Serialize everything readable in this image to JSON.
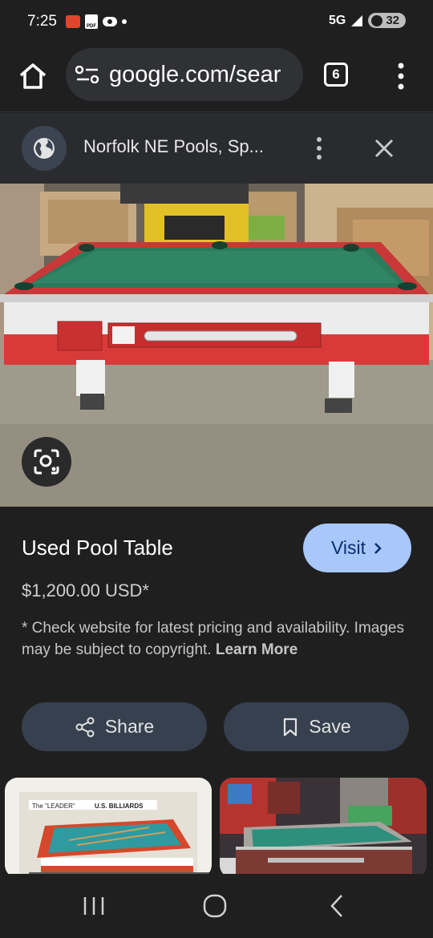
{
  "status_bar": {
    "time": "7:25",
    "network": "5G",
    "battery": "32",
    "icons": [
      "notification-app-icon",
      "pdf-icon",
      "eye-icon",
      "dot-icon",
      "signal-icon"
    ]
  },
  "browser": {
    "url": "google.com/sear",
    "tab_count": "6"
  },
  "source": {
    "title": "Norfolk NE Pools, Sp..."
  },
  "result": {
    "title": "Used Pool Table",
    "visit_label": "Visit",
    "price": "$1,200.00 USD*",
    "disclaimer": "* Check website for latest pricing and availability. Images may be subject to copyright.",
    "learn_more": "Learn More",
    "share_label": "Share",
    "save_label": "Save"
  },
  "thumbnails": {
    "sign_text_1": "The \"LEADER\"",
    "sign_text_2": "U.S. BILLIARDS"
  },
  "colors": {
    "accent": "#a8c7fa",
    "felt": "#2b7a5c",
    "table_red": "#d83a3a"
  }
}
